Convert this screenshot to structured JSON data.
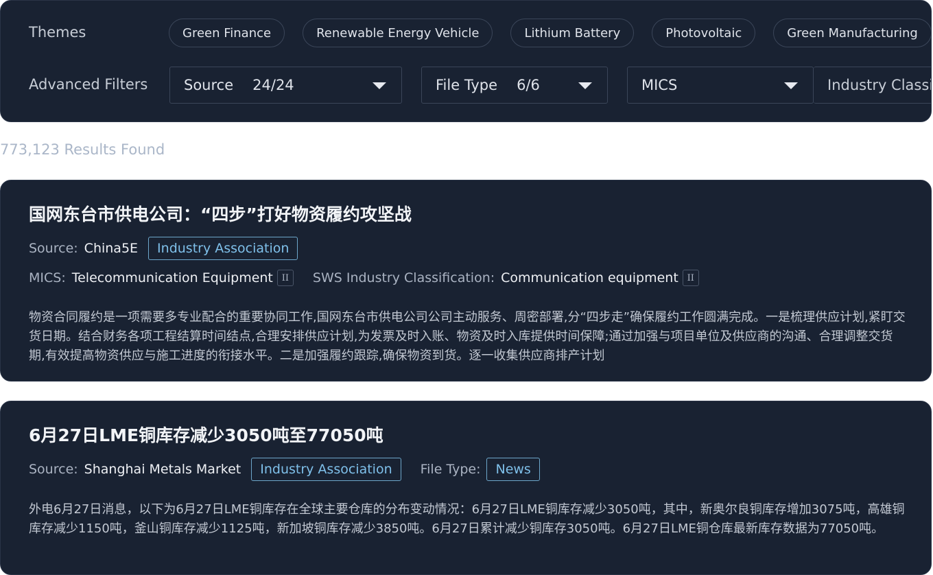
{
  "filters": {
    "themes_label": "Themes",
    "themes": [
      "Green Finance",
      "Renewable Energy Vehicle",
      "Lithium Battery",
      "Photovoltaic",
      "Green Manufacturing"
    ],
    "advanced_label": "Advanced Filters",
    "source": {
      "label": "Source",
      "value": "24/24"
    },
    "file_type": {
      "label": "File Type",
      "value": "6/6"
    },
    "mics": {
      "label": "MICS"
    },
    "industry": {
      "label": "Industry Classification"
    }
  },
  "results_count": "773,123 Results Found",
  "articles": [
    {
      "title": "国网东台市供电公司：“四步”打好物资履约攻坚战",
      "source_label": "Source:",
      "source": "China5E",
      "source_tag": "Industry Association",
      "mics_label": "MICS:",
      "mics": "Telecommunication Equipment",
      "mics_level": "II",
      "sws_label": "SWS Industry Classification:",
      "sws": "Communication equipment",
      "sws_level": "II",
      "body": "物资合同履约是一项需要多专业配合的重要协同工作,国网东台市供电公司公司主动服务、周密部署,分“四步走”确保履约工作圆满完成。一是梳理供应计划,紧盯交货日期。结合财务各项工程结算时间结点,合理安排供应计划,为发票及时入账、物资及时入库提供时间保障;通过加强与项目单位及供应商的沟通、合理调整交货期,有效提高物资供应与施工进度的衔接水平。二是加强履约跟踪,确保物资到货。逐一收集供应商排产计划"
    },
    {
      "title": "6月27日LME铜库存减少3050吨至77050吨",
      "source_label": "Source:",
      "source": "Shanghai Metals Market",
      "source_tag": "Industry Association",
      "file_type_label": "File Type:",
      "file_type": "News",
      "body": "外电6月27日消息，以下为6月27日LME铜库存在全球主要仓库的分布变动情况：6月27日LME铜库存减少3050吨，其中，新奥尔良铜库存增加3075吨，高雄铜库存减少1150吨，釜山铜库存减少1125吨，新加坡铜库存减少3850吨。6月27日累计减少铜库存3050吨。6月27日LME铜仓库最新库存数据为77050吨。"
    }
  ]
}
